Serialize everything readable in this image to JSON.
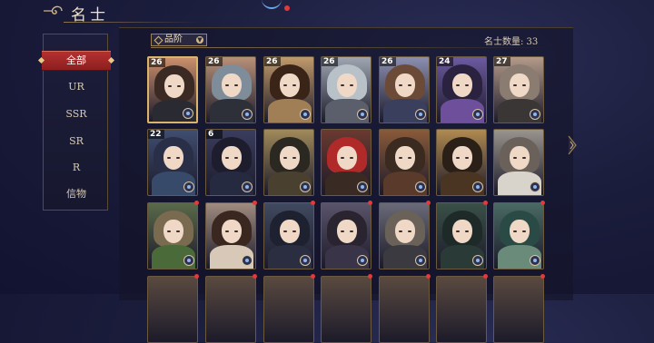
{
  "header": {
    "title": "名士",
    "colors": {
      "accent": "#b53030",
      "gold": "#d4b985",
      "bg": "#1b1d3c",
      "notification": "#e23a3a"
    }
  },
  "sidebar": {
    "items": [
      {
        "label": "全部",
        "active": true
      },
      {
        "label": "UR"
      },
      {
        "label": "SSR"
      },
      {
        "label": "SR"
      },
      {
        "label": "R"
      },
      {
        "label": "信物"
      }
    ]
  },
  "filter": {
    "label": "品阶"
  },
  "count_label": "名士数量: 33",
  "cards": [
    {
      "level": "26",
      "hair": "#3b2a24",
      "robe": "#2a2a33",
      "bg": "#c98f6c",
      "badge": "#5aa0e8",
      "selected": true
    },
    {
      "level": "26",
      "hair": "#7f8d9b",
      "robe": "#2d3038",
      "bg": "#b89178",
      "badge": "#9aa0a8"
    },
    {
      "level": "26",
      "hair": "#3a2418",
      "robe": "#a07f56",
      "bg": "#c09a6b",
      "badge": "#9aa0a8"
    },
    {
      "level": "26",
      "hair": "#b8c0c8",
      "robe": "#5a5f6b",
      "bg": "#9fa6b2",
      "badge": "#5aa0e8"
    },
    {
      "level": "26",
      "hair": "#6b4a38",
      "robe": "#3b3f5e",
      "bg": "#8c8fb0",
      "badge": "#7a5ad8"
    },
    {
      "level": "24",
      "hair": "#2b2240",
      "robe": "#6d4f9c",
      "bg": "#6c5aa0",
      "badge": "#9aa0a8"
    },
    {
      "level": "27",
      "hair": "#8a7c70",
      "robe": "#3a3636",
      "bg": "#b39a8a",
      "badge": "#9aa0a8"
    },
    {
      "level": "22",
      "hair": "#2a2f48",
      "robe": "#384a6a",
      "bg": "#404e70",
      "badge": "#9aa0a8"
    },
    {
      "level": "6",
      "hair": "#1e1d2e",
      "robe": "#262a40",
      "bg": "#3a3d5e",
      "badge": "#7a5ad8"
    },
    {
      "level": "",
      "hair": "#2a2820",
      "robe": "#4a4030",
      "bg": "#a08a5a",
      "badge": "#9aa0a8"
    },
    {
      "level": "",
      "hair": "#b02a2a",
      "robe": "#3a2a24",
      "bg": "#6a3a30",
      "badge": "#9aa0a8"
    },
    {
      "level": "",
      "hair": "#3a2a20",
      "robe": "#5a3a2a",
      "bg": "#8a5a3a",
      "badge": "#9aa0a8"
    },
    {
      "level": "",
      "hair": "#2a2018",
      "robe": "#4a3422",
      "bg": "#b08a50",
      "badge": "#9aa0a8"
    },
    {
      "level": "",
      "hair": "#6a625a",
      "robe": "#d8d4cc",
      "bg": "#9a948e",
      "badge": "#9aa0a8"
    },
    {
      "level": "",
      "hair": "#7a6a50",
      "robe": "#4a6a3a",
      "bg": "#5a6a4a",
      "badge": "#9aa0a8"
    },
    {
      "level": "",
      "hair": "#3a2820",
      "robe": "#d8c8b8",
      "bg": "#a08c80",
      "badge": "#5aa0e8"
    },
    {
      "level": "",
      "hair": "#1e2230",
      "robe": "#2a2e40",
      "bg": "#404a60",
      "badge": "#9aa0a8"
    },
    {
      "level": "",
      "hair": "#2a2430",
      "robe": "#3a3448",
      "bg": "#5a546a",
      "badge": "#9aa0a8"
    },
    {
      "level": "",
      "hair": "#6a6258",
      "robe": "#3a3a40",
      "bg": "#6a6a78",
      "badge": "#9aa0a8"
    },
    {
      "level": "",
      "hair": "#1e2a28",
      "robe": "#2a3a36",
      "bg": "#3a5048",
      "badge": "#9aa0a8"
    },
    {
      "level": "",
      "hair": "#2a4a46",
      "robe": "#6a8a7a",
      "bg": "#4a6a64",
      "badge": "#5aa0e8"
    }
  ]
}
